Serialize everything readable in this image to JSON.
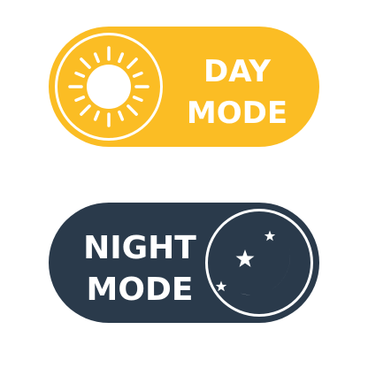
{
  "day_toggle": {
    "line1": "DAY",
    "line2": "MODE",
    "icon": "sun-icon",
    "color": "#fbbd24"
  },
  "night_toggle": {
    "line1": "NIGHT",
    "line2": "MODE",
    "icon": "moon-stars-icon",
    "color": "#2a3a4b"
  }
}
